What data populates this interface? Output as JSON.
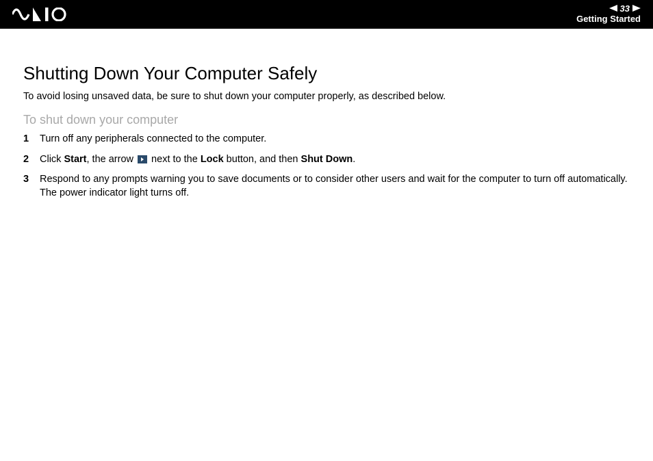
{
  "header": {
    "page_number": "33",
    "section": "Getting Started"
  },
  "title": "Shutting Down Your Computer Safely",
  "intro": "To avoid losing unsaved data, be sure to shut down your computer properly, as described below.",
  "subtitle": "To shut down your computer",
  "steps": [
    {
      "text": "Turn off any peripherals connected to the computer."
    },
    {
      "pre": "Click ",
      "b1": "Start",
      "mid1": ", the arrow ",
      "mid2": " next to the ",
      "b2": "Lock",
      "mid3": " button, and then ",
      "b3": "Shut Down",
      "post": "."
    },
    {
      "line1": "Respond to any prompts warning you to save documents or to consider other users and wait for the computer to turn off automatically.",
      "line2": "The power indicator light turns off."
    }
  ]
}
